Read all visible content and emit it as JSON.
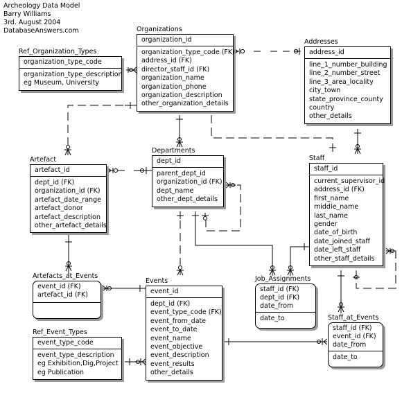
{
  "header": {
    "lines": [
      "Archeology Data Model",
      "Barry Williams",
      "3rd. August 2004",
      "DatabaseAnswers.com"
    ]
  },
  "entities": {
    "ref_org_types": {
      "title": "Ref_Organization_Types",
      "key": [
        "organization_type_code"
      ],
      "attributes": [
        "organization_type_description",
        "eg Museum, University"
      ]
    },
    "organizations": {
      "title": "Organizations",
      "key": [
        "organization_id"
      ],
      "attributes": [
        "organization_type_code (FK)",
        "address_id (FK)",
        "director_staff_id (FK)",
        "organization_name",
        "organization_phone",
        "organization_description",
        "other_organization_details"
      ]
    },
    "addresses": {
      "title": "Addresses",
      "key": [
        "address_id"
      ],
      "attributes": [
        "line_1_number_building",
        "line_2_number_street",
        "line_3_area_locality",
        "city_town",
        "state_province_county",
        "country",
        "other_details"
      ]
    },
    "artefact": {
      "title": "Artefact",
      "key": [
        "artefact_id"
      ],
      "attributes": [
        "dept_id (FK)",
        "organization_id (FK)",
        "artefact_date_range",
        "artefact_donor",
        "artefact_description",
        "other_artefact_details"
      ]
    },
    "departments": {
      "title": "Departments",
      "key": [
        "dept_id"
      ],
      "attributes": [
        "parent_dept_id",
        "organization_id (FK)",
        "dept_name",
        "other_dept_details"
      ]
    },
    "staff": {
      "title": "Staff",
      "key": [
        "staff_id"
      ],
      "attributes": [
        "current_supervisor_id",
        "address_id (FK)",
        "first_name",
        "middle_name",
        "last_name",
        "gender",
        "date_of_birth",
        "date_joined_staff",
        "date_left_staff",
        "other_staff_details"
      ]
    },
    "artefacts_at_events": {
      "title": "Artefacts_at_Events",
      "key": [
        "event_id (FK)",
        "artefact_id (FK)"
      ],
      "attributes": []
    },
    "events": {
      "title": "Events",
      "key": [
        "event_id"
      ],
      "attributes": [
        "dept_id (FK)",
        "event_type_code (FK)",
        "event_from_date",
        "event_to_date",
        "event_name",
        "event_objective",
        "event_description",
        "event_results",
        "other_details"
      ]
    },
    "job_assignments": {
      "title": "Job_Assignments",
      "key": [
        "staff_id (FK)",
        "dept_id (FK)",
        "date_from"
      ],
      "attributes": [
        "date_to"
      ]
    },
    "ref_event_types": {
      "title": "Ref_Event_Types",
      "key": [
        "event_type_code"
      ],
      "attributes": [
        "event_type_description",
        "eg Exhibition,Dig,Project",
        "eg Publication"
      ]
    },
    "staff_at_events": {
      "title": "Staff_at_Events",
      "key": [
        "staff_id (FK)",
        "event_id (FK)",
        "date_from"
      ],
      "attributes": [
        "date_to"
      ]
    }
  },
  "relationships": [
    {
      "from": "Ref_Organization_Types",
      "to": "Organizations",
      "style": "dashed",
      "cardinality": "one-to-zero-or-many"
    },
    {
      "from": "Addresses",
      "to": "Organizations",
      "style": "dashed",
      "cardinality": "zero-or-one-to-zero-or-many"
    },
    {
      "from": "Organizations",
      "to": "Artefact",
      "style": "dashed",
      "cardinality": "one-to-zero-or-many"
    },
    {
      "from": "Organizations",
      "to": "Departments",
      "style": "solid",
      "cardinality": "one-to-zero-or-many"
    },
    {
      "from": "Staff",
      "to": "Organizations",
      "style": "dashed",
      "cardinality": "one-to-zero-or-many"
    },
    {
      "from": "Addresses",
      "to": "Staff",
      "style": "solid",
      "cardinality": "one-to-zero-or-many"
    },
    {
      "from": "Departments",
      "to": "Artefact",
      "style": "dashed",
      "cardinality": "zero-or-one-to-zero-or-many"
    },
    {
      "from": "Departments",
      "to": "Departments",
      "style": "dashed",
      "cardinality": "zero-or-one-to-zero-or-many"
    },
    {
      "from": "Departments",
      "to": "Events",
      "style": "dashed",
      "cardinality": "one-to-zero-or-many"
    },
    {
      "from": "Departments",
      "to": "Job_Assignments",
      "style": "solid",
      "cardinality": "one-to-zero-or-many"
    },
    {
      "from": "Staff",
      "to": "Job_Assignments",
      "style": "solid",
      "cardinality": "one-to-zero-or-many"
    },
    {
      "from": "Staff",
      "to": "Staff",
      "style": "dashed",
      "cardinality": "zero-or-one-to-zero-or-many"
    },
    {
      "from": "Staff",
      "to": "Staff_at_Events",
      "style": "solid",
      "cardinality": "one-to-zero-or-many"
    },
    {
      "from": "Artefact",
      "to": "Artefacts_at_Events",
      "style": "solid",
      "cardinality": "one-to-zero-or-many"
    },
    {
      "from": "Events",
      "to": "Artefacts_at_Events",
      "style": "solid",
      "cardinality": "one-to-zero-or-many"
    },
    {
      "from": "Events",
      "to": "Staff_at_Events",
      "style": "solid",
      "cardinality": "one-to-zero-or-many"
    },
    {
      "from": "Ref_Event_Types",
      "to": "Events",
      "style": "solid",
      "cardinality": "one-to-zero-or-many"
    }
  ]
}
